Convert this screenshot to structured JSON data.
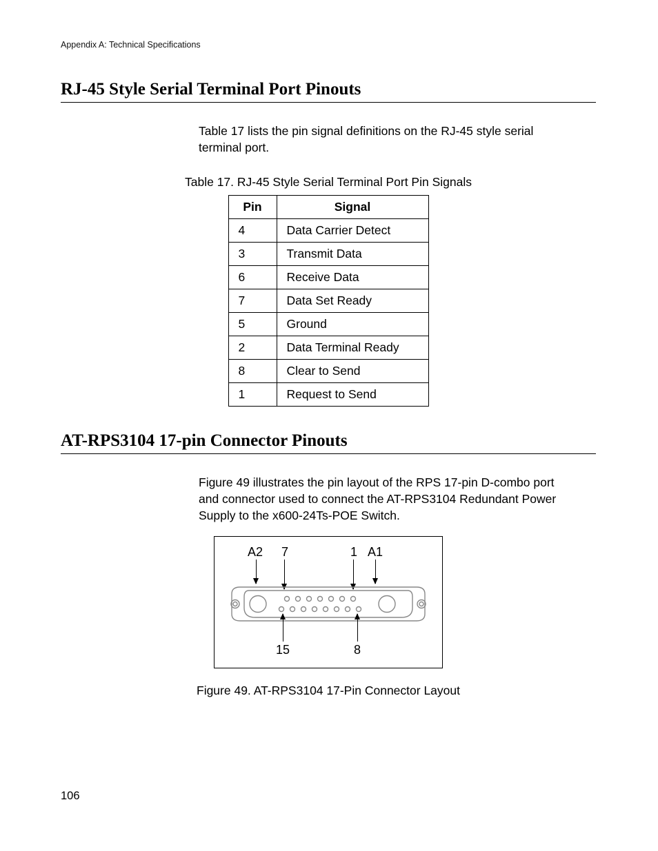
{
  "runningHead": "Appendix A: Technical Specifications",
  "pageNumber": "106",
  "section1": {
    "title": "RJ-45 Style Serial Terminal Port Pinouts",
    "intro": "Table 17 lists the pin signal definitions on the RJ-45 style serial terminal port.",
    "tableCaption": "Table 17. RJ-45 Style Serial Terminal Port Pin Signals",
    "headers": {
      "pin": "Pin",
      "signal": "Signal"
    },
    "rows": [
      {
        "pin": "4",
        "signal": "Data Carrier Detect"
      },
      {
        "pin": "3",
        "signal": "Transmit Data"
      },
      {
        "pin": "6",
        "signal": "Receive Data"
      },
      {
        "pin": "7",
        "signal": "Data Set Ready"
      },
      {
        "pin": "5",
        "signal": "Ground"
      },
      {
        "pin": "2",
        "signal": "Data Terminal Ready"
      },
      {
        "pin": "8",
        "signal": "Clear to Send"
      },
      {
        "pin": "1",
        "signal": "Request to Send"
      }
    ]
  },
  "section2": {
    "title": "AT-RPS3104 17-pin Connector Pinouts",
    "intro": "Figure 49 illustrates the pin layout of the RPS 17-pin D-combo port and connector used to connect the AT-RPS3104 Redundant Power Supply to the x600-24Ts-POE Switch.",
    "figureCaption": "Figure 49. AT-RPS3104 17-Pin Connector Layout",
    "labels": {
      "A2": "A2",
      "seven": "7",
      "one": "1",
      "A1": "A1",
      "fifteen": "15",
      "eight": "8"
    }
  }
}
